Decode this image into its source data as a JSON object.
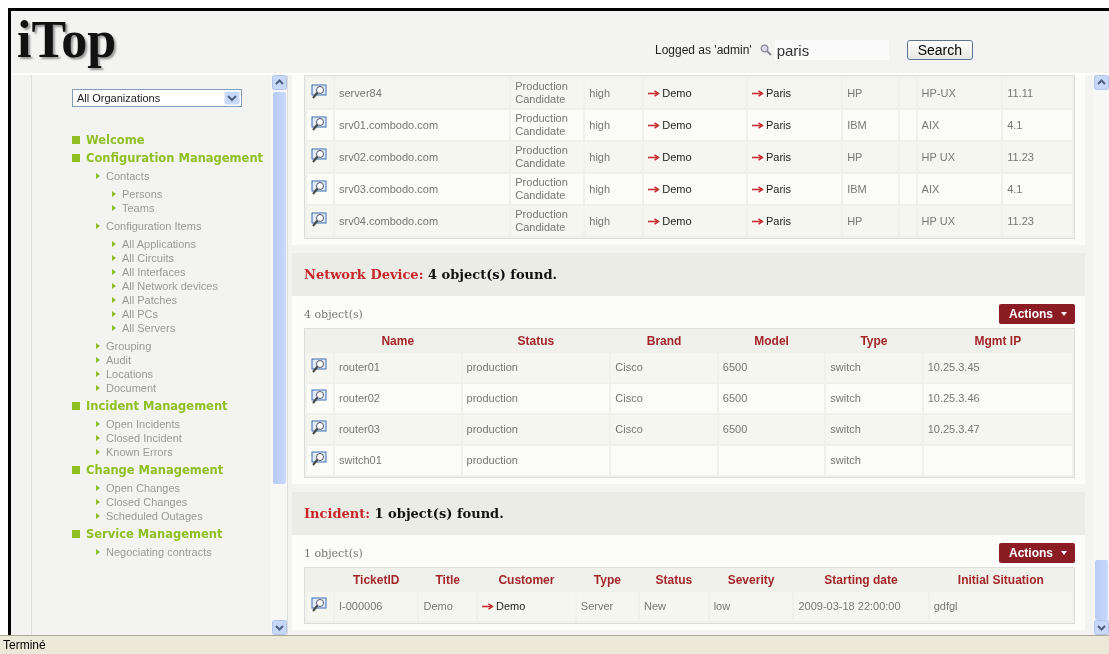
{
  "header": {
    "logo": "iTop",
    "user": "Logged as 'admin'",
    "search": {
      "value": "paris"
    },
    "search_button": "Search"
  },
  "sidebar": {
    "organization": "All Organizations",
    "menu": [
      {
        "label": "Welcome"
      },
      {
        "label": "Configuration Management",
        "children": [
          {
            "label": "Contacts",
            "children": [
              {
                "label": "Persons"
              },
              {
                "label": "Teams"
              }
            ]
          },
          {
            "label": "Configuration Items",
            "children": [
              {
                "label": "All Applications"
              },
              {
                "label": "All Circuits"
              },
              {
                "label": "All Interfaces"
              },
              {
                "label": "All Network devices"
              },
              {
                "label": "All Patches"
              },
              {
                "label": "All PCs"
              },
              {
                "label": "All Servers"
              }
            ]
          },
          {
            "label": "Grouping"
          },
          {
            "label": "Audit"
          },
          {
            "label": "Locations"
          },
          {
            "label": "Document"
          }
        ]
      },
      {
        "label": "Incident Management",
        "children": [
          {
            "label": "Open Incidents"
          },
          {
            "label": "Closed Incident"
          },
          {
            "label": "Known Errors"
          }
        ]
      },
      {
        "label": "Change Management",
        "children": [
          {
            "label": "Open Changes"
          },
          {
            "label": "Closed Changes"
          },
          {
            "label": "Scheduled Outages"
          }
        ]
      },
      {
        "label": "Service Management",
        "children": [
          {
            "label": "Negociating contracts"
          }
        ]
      }
    ]
  },
  "sections": [
    {
      "kind": "rows-only",
      "columns": [
        {
          "kind": "text"
        },
        {
          "kind": "wrap"
        },
        {
          "kind": "text"
        },
        {
          "kind": "link"
        },
        {
          "kind": "link"
        },
        {
          "kind": "text"
        },
        {
          "kind": "text"
        },
        {
          "kind": "text"
        },
        {
          "kind": "text"
        }
      ],
      "rows": [
        [
          "server84",
          "Production Candidate",
          "high",
          "Demo",
          "Paris",
          "HP",
          null,
          "HP-UX",
          "11.11"
        ],
        [
          "srv01.combodo.com",
          "Production Candidate",
          "high",
          "Demo",
          "Paris",
          "IBM",
          null,
          "AIX",
          "4.1"
        ],
        [
          "srv02.combodo.com",
          "Production Candidate",
          "high",
          "Demo",
          "Paris",
          "HP",
          null,
          "HP UX",
          "11.23"
        ],
        [
          "srv03.combodo.com",
          "Production Candidate",
          "high",
          "Demo",
          "Paris",
          "IBM",
          null,
          "AIX",
          "4.1"
        ],
        [
          "srv04.combodo.com",
          "Production Candidate",
          "high",
          "Demo",
          "Paris",
          "HP",
          null,
          "HP UX",
          "11.23"
        ]
      ]
    },
    {
      "kind": "full",
      "class": "Network Device:",
      "found": "4 object(s) found.",
      "count": "4 object(s)",
      "actions": "Actions",
      "columns": [
        {
          "kind": "text",
          "label": "Name"
        },
        {
          "kind": "text",
          "label": "Status"
        },
        {
          "kind": "text",
          "label": "Brand"
        },
        {
          "kind": "text",
          "label": "Model"
        },
        {
          "kind": "text",
          "label": "Type"
        },
        {
          "kind": "text",
          "label": "Mgmt IP"
        }
      ],
      "rows": [
        [
          "router01",
          "production",
          "Cisco",
          "6500",
          "switch",
          "10.25.3.45"
        ],
        [
          "router02",
          "production",
          "Cisco",
          "6500",
          "switch",
          "10.25.3.46"
        ],
        [
          "router03",
          "production",
          "Cisco",
          "6500",
          "switch",
          "10.25.3.47"
        ],
        [
          "switch01",
          "production",
          null,
          null,
          "switch",
          null
        ]
      ]
    },
    {
      "kind": "full",
      "class": "Incident:",
      "found": "1 object(s) found.",
      "count": "1 object(s)",
      "actions": "Actions",
      "columns": [
        {
          "kind": "text",
          "label": "TicketID"
        },
        {
          "kind": "text",
          "label": "Title"
        },
        {
          "kind": "link",
          "label": "Customer"
        },
        {
          "kind": "text",
          "label": "Type"
        },
        {
          "kind": "text",
          "label": "Status"
        },
        {
          "kind": "text",
          "label": "Severity"
        },
        {
          "kind": "text",
          "label": "Starting date"
        },
        {
          "kind": "text",
          "label": "Initial Situation"
        }
      ],
      "rows": [
        [
          "I-000006",
          "Demo",
          "Demo",
          "Server",
          "New",
          "low",
          "2009-03-18 22:00:00",
          "gdfgl"
        ]
      ]
    }
  ],
  "status_bar": "Terminé"
}
